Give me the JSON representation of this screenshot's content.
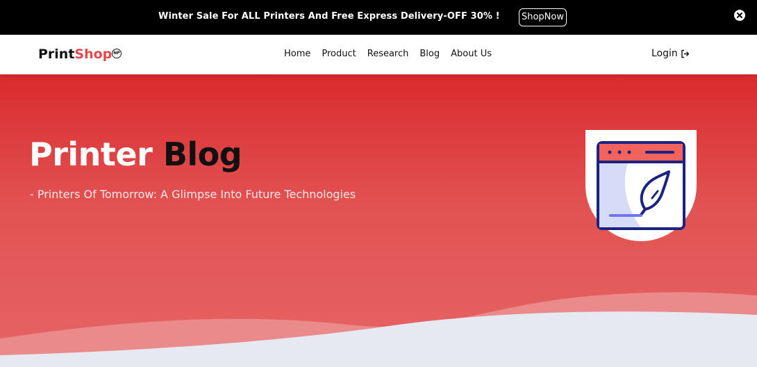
{
  "announcement": {
    "text": "Winter Sale For ALL Printers And Free Express Delivery-OFF 30% !",
    "button_label": "ShopNow",
    "close_icon": "close-icon"
  },
  "navbar": {
    "logo": {
      "part1": "Print",
      "part2": "Shop",
      "badge": "NP"
    },
    "links": [
      "Home",
      "Product",
      "Research",
      "Blog",
      "About Us"
    ],
    "login_label": "Login",
    "login_icon": "sign-in-icon"
  },
  "hero": {
    "title_part1": "Printer",
    "title_part2": "Blog",
    "subtitle": "- Printers Of Tomorrow: A Glimpse Into Future Technologies",
    "illustration_icon": "blog-quill-icon"
  },
  "colors": {
    "brand_red": "#e5474b",
    "hero_top": "#d92b2e",
    "hero_bottom": "#e66565",
    "navy": "#1a237e",
    "page_bg": "#e6e9f2"
  }
}
